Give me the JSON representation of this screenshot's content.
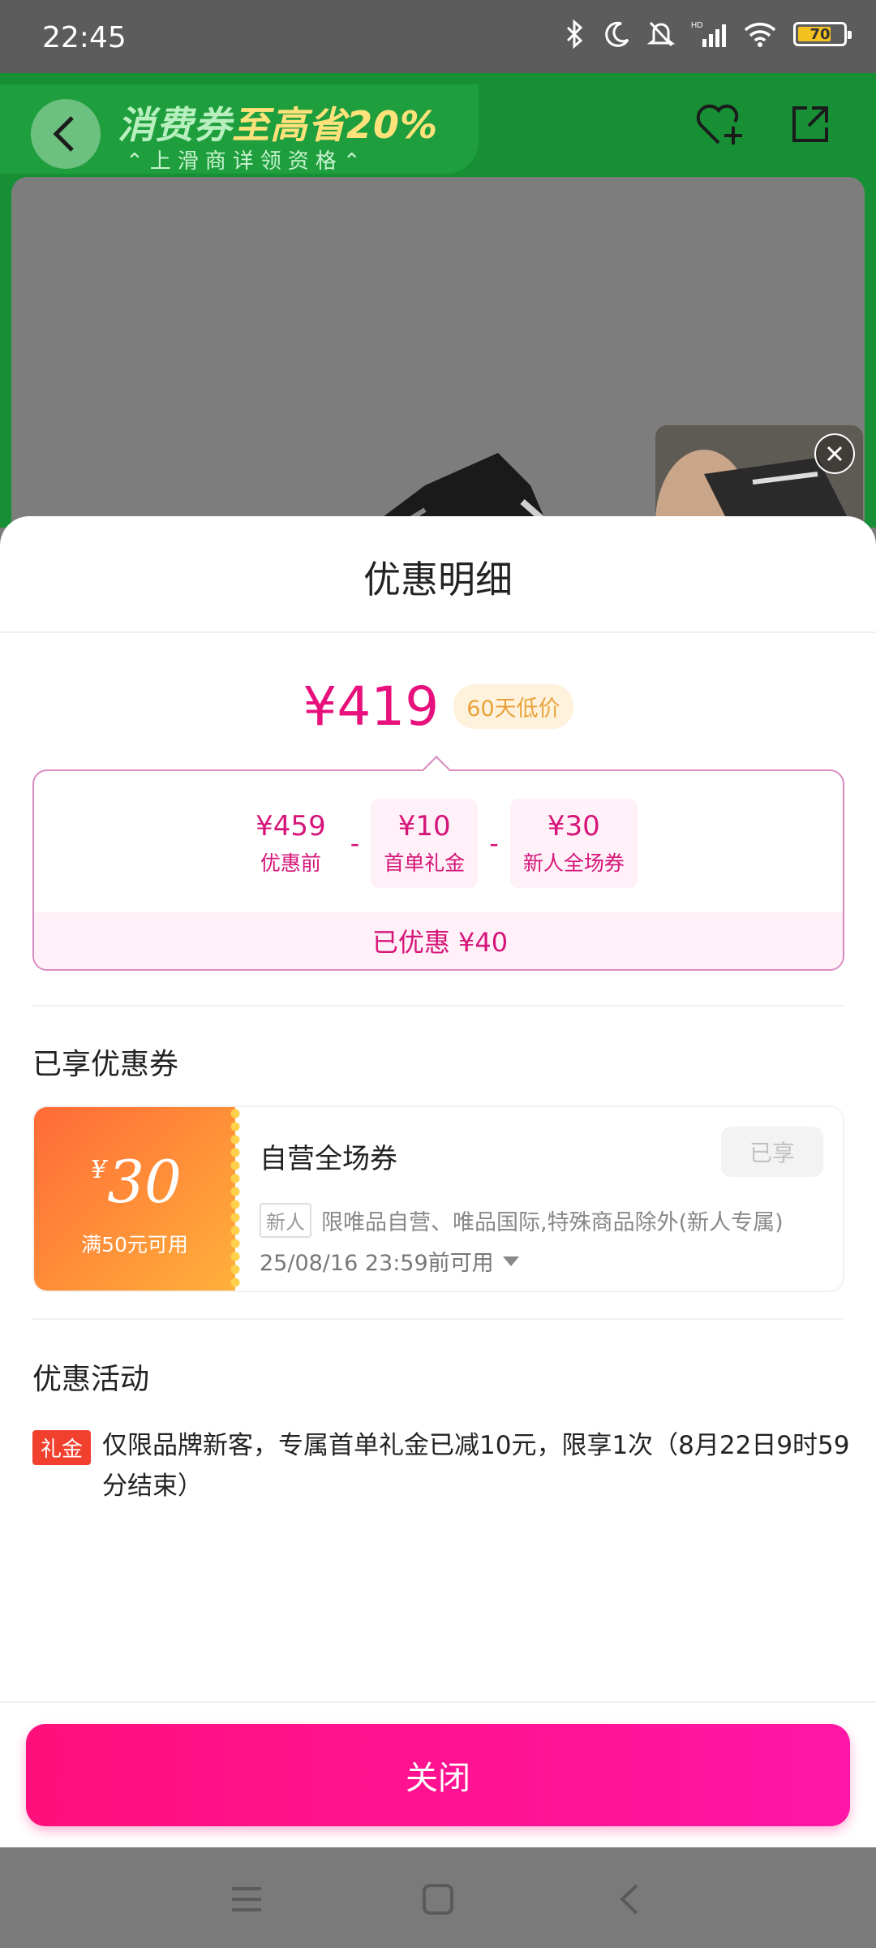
{
  "status_bar": {
    "time": "22:45",
    "battery": "70",
    "icons": [
      "bluetooth-icon",
      "moon-icon",
      "bell-mute-icon",
      "signal-icon",
      "wifi-icon",
      "battery-icon"
    ]
  },
  "product_header": {
    "promo_title_a": "消费券",
    "promo_title_b": "至高省20%",
    "promo_subtitle": "⌃上滑商详领资格⌃",
    "icons": [
      "back-icon",
      "favorite-add-icon",
      "share-icon",
      "close-icon"
    ]
  },
  "sheet": {
    "title": "优惠明细",
    "price": "¥419",
    "price_badge": "60天低价",
    "breakdown": [
      {
        "amount": "¥459",
        "label": "优惠前"
      },
      {
        "amount": "¥10",
        "label": "首单礼金"
      },
      {
        "amount": "¥30",
        "label": "新人全场券"
      }
    ],
    "operator": "-",
    "total_saved": "已优惠 ¥40",
    "coupons_section_title": "已享优惠券",
    "coupon": {
      "currency": "¥",
      "value": "30",
      "condition": "满50元可用",
      "name": "自营全场券",
      "status": "已享",
      "tag": "新人",
      "description": "限唯品自营、唯品国际,特殊商品除外(新人专属)",
      "expiry": "25/08/16 23:59前可用"
    },
    "activity_section_title": "优惠活动",
    "activity": {
      "tag": "礼金",
      "text": "仅限品牌新客，专属首单礼金已减10元，限享1次（8月22日9时59分结束）"
    },
    "close_label": "关闭"
  },
  "colors": {
    "accent": "#e8107d",
    "button": "#ff0f7b",
    "coupon_start": "#ff6a37",
    "coupon_end": "#ffb13a",
    "badge_text": "#e9a23b",
    "banner_green": "#168f35"
  }
}
